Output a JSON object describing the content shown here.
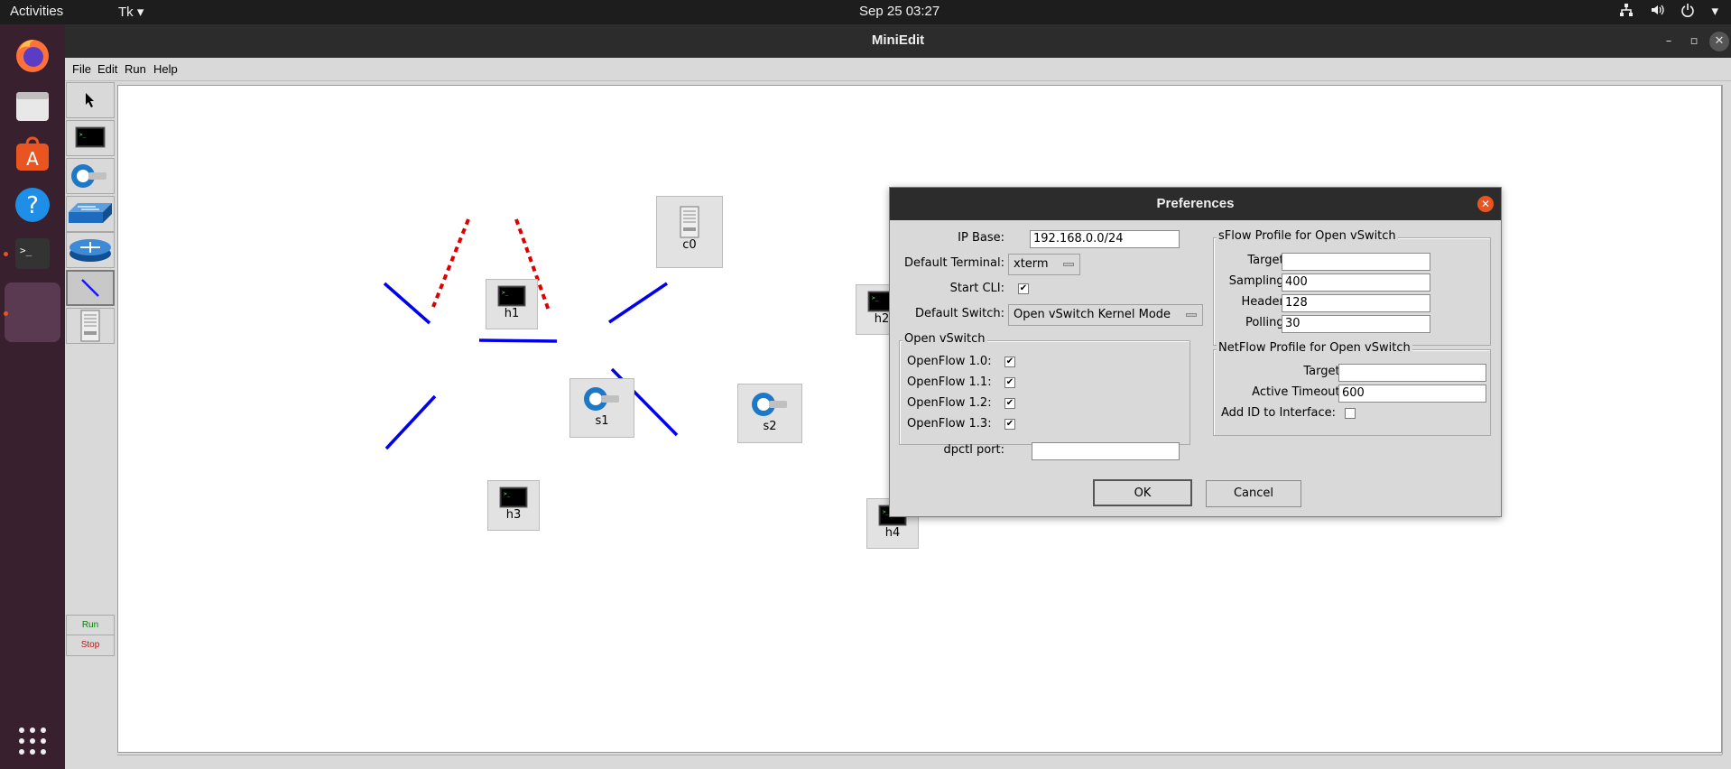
{
  "topbar": {
    "activities": "Activities",
    "app_menu": "Tk",
    "clock": "Sep 25  03:27"
  },
  "window": {
    "title": "MiniEdit",
    "menu": [
      "File",
      "Edit",
      "Run",
      "Help"
    ]
  },
  "toolbar": {
    "tools": [
      "select-tool",
      "host-tool",
      "switch-tool",
      "legacy-switch-tool",
      "router-tool",
      "link-tool",
      "controller-tool"
    ],
    "run_label": "Run",
    "stop_label": "Stop"
  },
  "topology": {
    "nodes": [
      {
        "id": "c0",
        "type": "controller"
      },
      {
        "id": "h1",
        "type": "host"
      },
      {
        "id": "h2",
        "type": "host"
      },
      {
        "id": "h3",
        "type": "host"
      },
      {
        "id": "h4",
        "type": "host"
      },
      {
        "id": "s1",
        "type": "switch"
      },
      {
        "id": "s2",
        "type": "switch"
      }
    ],
    "links": [
      {
        "from": "h1",
        "to": "s1",
        "style": "data"
      },
      {
        "from": "h3",
        "to": "s1",
        "style": "data"
      },
      {
        "from": "s1",
        "to": "s2",
        "style": "data"
      },
      {
        "from": "s2",
        "to": "h2",
        "style": "data"
      },
      {
        "from": "s2",
        "to": "h4",
        "style": "data"
      },
      {
        "from": "c0",
        "to": "s1",
        "style": "control"
      },
      {
        "from": "c0",
        "to": "s2",
        "style": "control"
      }
    ],
    "colors": {
      "data_link": "#0000ee",
      "control_link": "#dd0000"
    }
  },
  "preferences": {
    "title": "Preferences",
    "ip_base_label": "IP Base:",
    "ip_base_value": "192.168.0.0/24",
    "default_terminal_label": "Default Terminal:",
    "default_terminal_value": "xterm",
    "start_cli_label": "Start CLI:",
    "start_cli_checked": true,
    "default_switch_label": "Default Switch:",
    "default_switch_value": "Open vSwitch Kernel Mode",
    "ovs_group_label": "Open vSwitch",
    "openflow": [
      {
        "label": "OpenFlow 1.0:",
        "checked": true
      },
      {
        "label": "OpenFlow 1.1:",
        "checked": true
      },
      {
        "label": "OpenFlow 1.2:",
        "checked": true
      },
      {
        "label": "OpenFlow 1.3:",
        "checked": true
      }
    ],
    "dpctl_label": "dpctl port:",
    "dpctl_value": "",
    "sflow": {
      "group_label": "sFlow Profile for Open vSwitch",
      "target_label": "Target:",
      "target_value": "",
      "sampling_label": "Sampling:",
      "sampling_value": "400",
      "header_label": "Header:",
      "header_value": "128",
      "polling_label": "Polling:",
      "polling_value": "30"
    },
    "netflow": {
      "group_label": "NetFlow Profile for Open vSwitch",
      "target_label": "Target:",
      "target_value": "",
      "timeout_label": "Active Timeout:",
      "timeout_value": "600",
      "addid_label": "Add ID to Interface:",
      "addid_checked": false
    },
    "ok_label": "OK",
    "cancel_label": "Cancel"
  }
}
